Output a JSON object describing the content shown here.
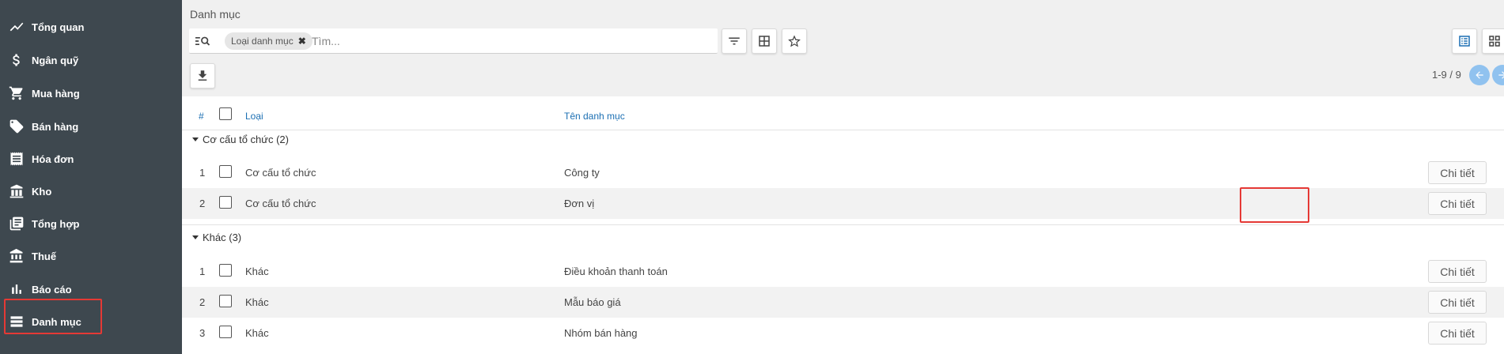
{
  "sidebar": {
    "items": [
      {
        "label": "Tổng quan",
        "icon": "trending-up-icon"
      },
      {
        "label": "Ngân quỹ",
        "icon": "dollar-icon"
      },
      {
        "label": "Mua hàng",
        "icon": "cart-icon"
      },
      {
        "label": "Bán hàng",
        "icon": "tag-icon"
      },
      {
        "label": "Hóa đơn",
        "icon": "receipt-icon"
      },
      {
        "label": "Kho",
        "icon": "warehouse-icon"
      },
      {
        "label": "Tổng hợp",
        "icon": "library-books-icon"
      },
      {
        "label": "Thuế",
        "icon": "bank-icon"
      },
      {
        "label": "Báo cáo",
        "icon": "bar-chart-icon"
      },
      {
        "label": "Danh mục",
        "icon": "list-icon"
      }
    ],
    "active": "Danh mục",
    "background": "#3e484f"
  },
  "breadcrumb": "Danh mục",
  "search": {
    "chip_label": "Loại danh mục",
    "placeholder": "Tìm..."
  },
  "pager": {
    "range": "1-9 / 9"
  },
  "table": {
    "headers": {
      "index": "#",
      "type": "Loại",
      "name": "Tên danh mục"
    },
    "groups": [
      {
        "title": "Cơ cấu tổ chức (2)",
        "rows": [
          {
            "index": "1",
            "type": "Cơ cấu tổ chức",
            "name": "Công ty",
            "action": "Chi tiết"
          },
          {
            "index": "2",
            "type": "Cơ cấu tổ chức",
            "name": "Đơn vị",
            "action": "Chi tiết"
          }
        ]
      },
      {
        "title": "Khác (3)",
        "rows": [
          {
            "index": "1",
            "type": "Khác",
            "name": "Điều khoản thanh toán",
            "action": "Chi tiết"
          },
          {
            "index": "2",
            "type": "Khác",
            "name": "Mẫu báo giá",
            "action": "Chi tiết"
          },
          {
            "index": "3",
            "type": "Khác",
            "name": "Nhóm bán hàng",
            "action": "Chi tiết"
          }
        ]
      }
    ]
  },
  "colors": {
    "accent": "#1b6fb3",
    "highlight": "#e53935"
  }
}
